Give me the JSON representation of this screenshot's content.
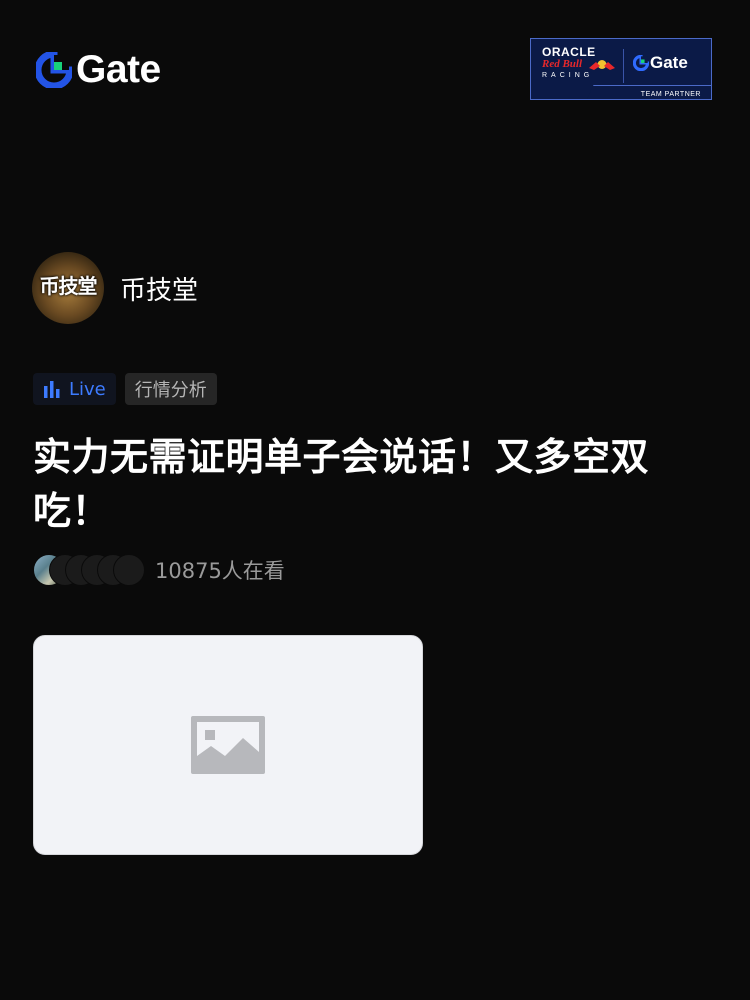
{
  "header": {
    "logo_text": "Gate",
    "partner": {
      "oracle": "ORACLE",
      "redbull": "Red Bull",
      "racing": "RACING",
      "gate": "Gate",
      "team_partner": "TEAM PARTNER"
    }
  },
  "author": {
    "avatar_text": "币技堂",
    "name": "币技堂"
  },
  "tags": {
    "live_label": "Live",
    "category_label": "行情分析"
  },
  "post": {
    "title": "实力无需证明单子会说话！又多空双吃！"
  },
  "viewers": {
    "text": "10875人在看"
  },
  "colors": {
    "background": "#0a0a0a",
    "live_blue": "#3d7bff",
    "brand_blue": "#2354e6",
    "brand_green": "#18d27a",
    "placeholder_bg": "#f2f3f7",
    "placeholder_icon": "#b7b8bc"
  },
  "icons": {
    "logo_mark": "gate-logo-icon",
    "live": "bar-chart-icon",
    "cover": "image-placeholder-icon"
  }
}
